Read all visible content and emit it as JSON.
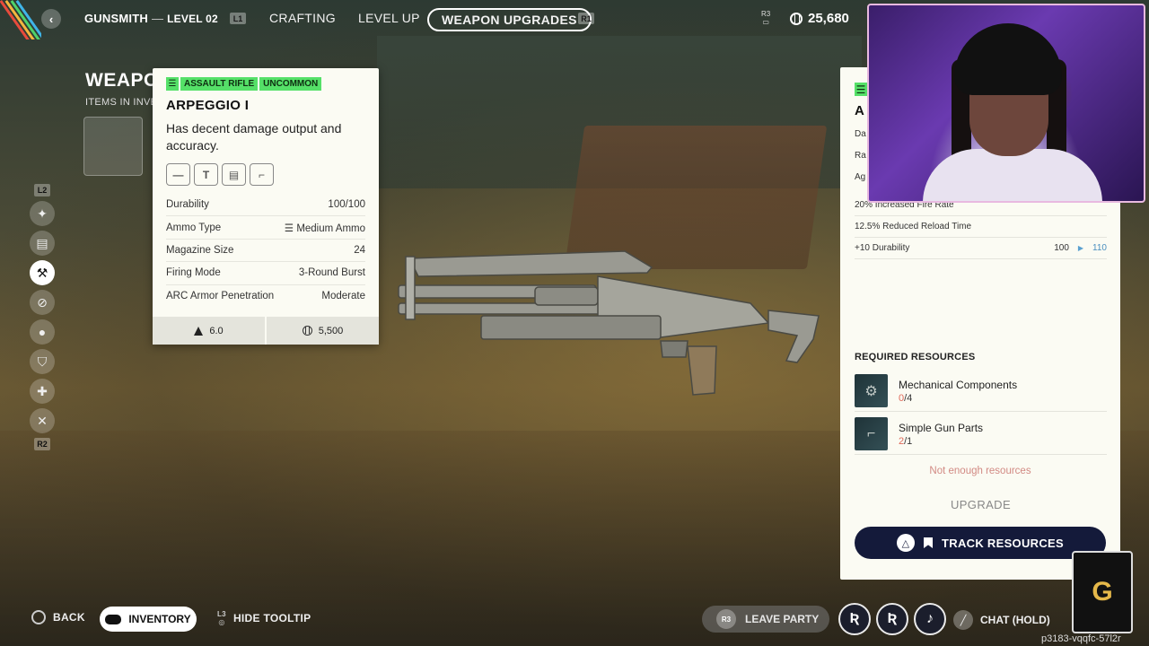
{
  "top_nav": {
    "back_icon": "chevron-left-icon",
    "section": "GUNSMITH",
    "separator": "—",
    "level": "LEVEL 02",
    "hint_left": "L1",
    "tabs": [
      {
        "label": "CRAFTING",
        "active": false
      },
      {
        "label": "LEVEL UP",
        "active": false
      },
      {
        "label": "WEAPON UPGRADES",
        "active": true
      }
    ],
    "hint_right": "R1",
    "hint_r3": "R3",
    "currency_value": "25,680"
  },
  "left_header": {
    "title": "WEAPO",
    "subtitle": "ITEMS IN INVE"
  },
  "side_nav": {
    "top_trigger": "L2",
    "bottom_trigger": "R2",
    "icons": [
      "weapons-icon",
      "storage-icon",
      "upgrade-bench-icon",
      "no-gear-icon",
      "grenade-icon",
      "shield-icon",
      "medkit-icon",
      "tools-icon"
    ],
    "active_index": 2
  },
  "tooltip": {
    "tags": [
      "ASSAULT RIFLE",
      "UNCOMMON"
    ],
    "tag_color": "#55e068",
    "name": "ARPEGGIO I",
    "description": "Has decent damage output and accuracy.",
    "mod_slots": [
      "—",
      "T",
      "▤",
      "⌐"
    ],
    "stats": [
      {
        "label": "Durability",
        "value": "100/100"
      },
      {
        "label": "Ammo Type",
        "value": "Medium Ammo"
      },
      {
        "label": "Magazine Size",
        "value": "24"
      },
      {
        "label": "Firing Mode",
        "value": "3-Round Burst"
      },
      {
        "label": "ARC Armor Penetration",
        "value": "Moderate"
      }
    ],
    "weight": "6.0",
    "price": "5,500"
  },
  "upgrade_panel": {
    "partial_title": "A",
    "partial_labels": [
      "Da",
      "Ra",
      "Ag"
    ],
    "effects": [
      {
        "label": "20% Increased Fire Rate"
      },
      {
        "label": "12.5% Reduced Reload Time"
      },
      {
        "label": "+10 Durability",
        "from": "100",
        "to": "110"
      }
    ],
    "required_heading": "REQUIRED RESOURCES",
    "resources": [
      {
        "name": "Mechanical Components",
        "have": "0",
        "need": "/4"
      },
      {
        "name": "Simple Gun Parts",
        "have": "2",
        "need": "/1"
      }
    ],
    "warning": "Not enough resources",
    "upgrade_label": "UPGRADE",
    "track_label": "TRACK RESOURCES",
    "track_color": "#141a3a"
  },
  "bottom_bar": {
    "back_label": "BACK",
    "inventory_label": "INVENTORY",
    "l3_hint": "L3",
    "hide_tooltip_label": "HIDE TOOLTIP",
    "r3_hint": "R3",
    "leave_party_label": "LEAVE PARTY",
    "chat_label": "CHAT (HOLD)",
    "stream_id": "p3183-vqqfc-57l2r"
  }
}
